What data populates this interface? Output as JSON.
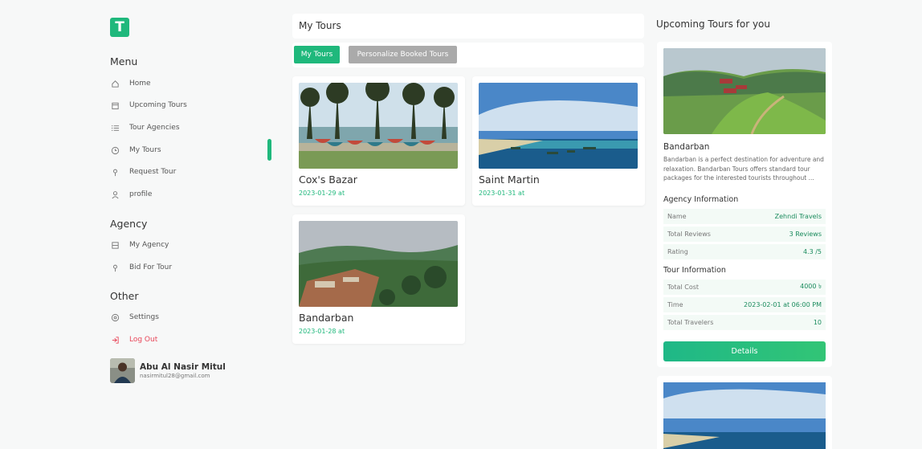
{
  "logo_letter": "T",
  "sidebar": {
    "menu_title": "Menu",
    "menu_items": [
      {
        "label": "Home",
        "icon": "home-icon"
      },
      {
        "label": "Upcoming Tours",
        "icon": "calendar-icon"
      },
      {
        "label": "Tour Agencies",
        "icon": "list-icon"
      },
      {
        "label": "My Tours",
        "icon": "clock-icon"
      },
      {
        "label": "Request Tour",
        "icon": "pin-icon"
      },
      {
        "label": "profile",
        "icon": "user-icon"
      }
    ],
    "agency_title": "Agency",
    "agency_items": [
      {
        "label": "My Agency",
        "icon": "building-icon"
      },
      {
        "label": "Bid For Tour",
        "icon": "pin-icon"
      }
    ],
    "other_title": "Other",
    "other_items": [
      {
        "label": "Settings",
        "icon": "gear-icon"
      },
      {
        "label": "Log Out",
        "icon": "logout-icon"
      }
    ],
    "user": {
      "name": "Abu Al Nasir Mitul",
      "email": "nasirmitul28@gmail.com"
    }
  },
  "main": {
    "title": "My Tours",
    "tabs": [
      "My Tours",
      "Personalize Booked Tours"
    ],
    "tours": [
      {
        "name": "Cox's Bazar",
        "date": "2023-01-29 at"
      },
      {
        "name": "Saint Martin",
        "date": "2023-01-31 at"
      },
      {
        "name": "Bandarban",
        "date": "2023-01-28 at"
      }
    ]
  },
  "right": {
    "title": "Upcoming Tours for you",
    "card": {
      "name": "Bandarban",
      "description": "Bandarban is a perfect destination for adventure and relaxation. Bandarban Tours offers standard tour packages for the interested tourists throughout ...",
      "agency_title": "Agency Information",
      "agency_rows": [
        {
          "label": "Name",
          "value": "Zehndi Travels"
        },
        {
          "label": "Total Reviews",
          "value": "3 Reviews"
        },
        {
          "label": "Rating",
          "value": "4.3 /5"
        }
      ],
      "tour_title": "Tour Information",
      "tour_rows": [
        {
          "label": "Total Cost",
          "value": "4000 ৳"
        },
        {
          "label": "Time",
          "value": "2023-02-01 at 06:00 PM"
        },
        {
          "label": "Total Travelers",
          "value": "10"
        }
      ],
      "button": "Details"
    }
  },
  "colors": {
    "accent": "#1fb87c",
    "danger": "#e8475a",
    "inactive_tab": "#aaaaaa"
  }
}
